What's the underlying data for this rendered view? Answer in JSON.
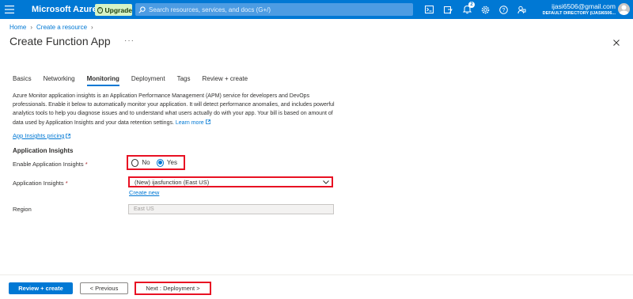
{
  "topbar": {
    "brand": "Microsoft Azure",
    "upgrade_label": "Upgrade",
    "search_placeholder": "Search resources, services, and docs (G+/)",
    "notification_count": "2",
    "account_email": "ijasi6506@gmail.com",
    "account_directory": "DEFAULT DIRECTORY (IJASI6506...",
    "brand_color": "#0078d4"
  },
  "breadcrumb": {
    "home": "Home",
    "create_resource": "Create a resource"
  },
  "page": {
    "title": "Create Function App",
    "more": "···"
  },
  "tabs": [
    {
      "label": "Basics"
    },
    {
      "label": "Networking"
    },
    {
      "label": "Monitoring"
    },
    {
      "label": "Deployment"
    },
    {
      "label": "Tags"
    },
    {
      "label": "Review + create"
    }
  ],
  "active_tab": "Monitoring",
  "description": {
    "text": "Azure Monitor application insights is an Application Performance Management (APM) service for developers and DevOps professionals. Enable it below to automatically monitor your application. It will detect performance anomalies, and includes powerful analytics tools to help you diagnose issues and to understand what users actually do with your app. Your bill is based on amount of data used by Application Insights and your data retention settings.",
    "learn_more": "Learn more"
  },
  "pricing_link": "App Insights pricing",
  "section_title": "Application Insights",
  "form": {
    "enable_label": "Enable Application Insights",
    "enable_options": [
      "No",
      "Yes"
    ],
    "enable_selected": "Yes",
    "app_insights_label": "Application Insights",
    "app_insights_value": "(New) ijasfunction (East US)",
    "create_new": "Create new",
    "region_label": "Region",
    "region_value": "East US",
    "required_mark": "*"
  },
  "footer": {
    "review_create": "Review + create",
    "previous": "< Previous",
    "next": "Next : Deployment >"
  }
}
